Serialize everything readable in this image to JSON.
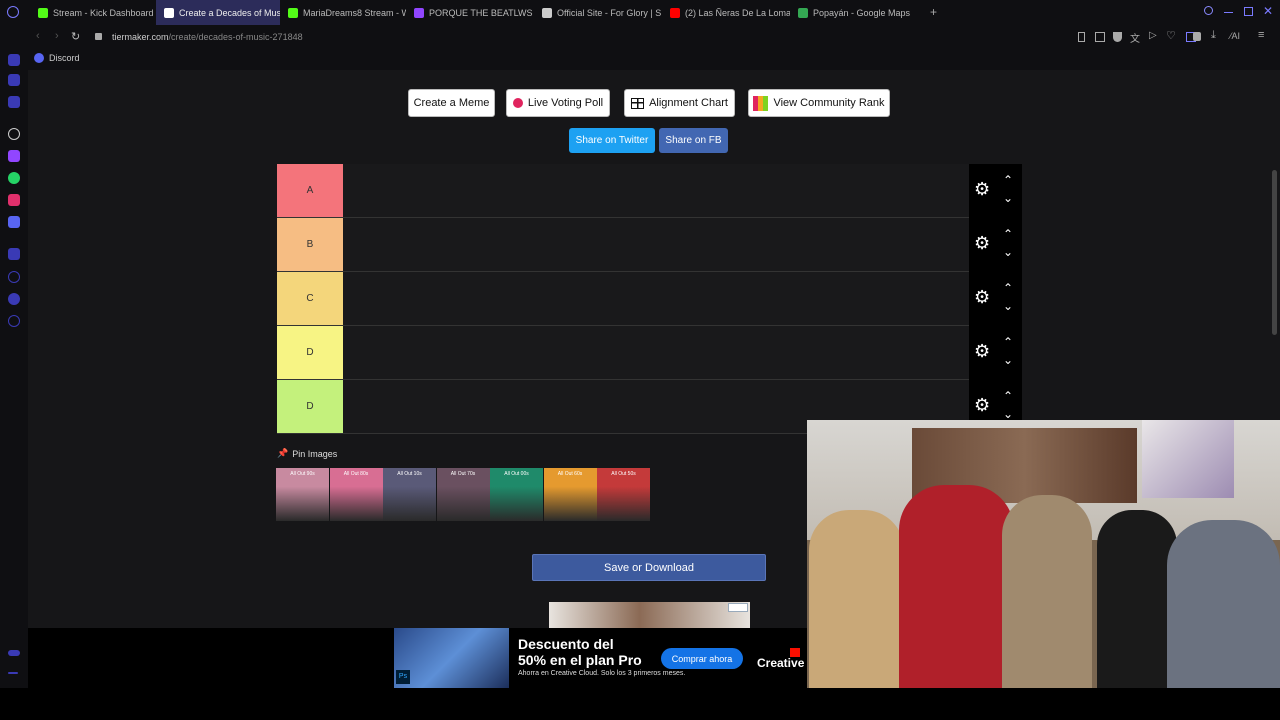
{
  "tabs": [
    {
      "label": "Stream - Kick Dashboard",
      "icon": "kick-icon",
      "color": "#53fc18"
    },
    {
      "label": "Create a Decades of Musi",
      "icon": "tiermaker-icon",
      "color": "#ffffff"
    },
    {
      "label": "MariaDreams8 Stream - W",
      "icon": "kick-icon",
      "color": "#53fc18"
    },
    {
      "label": "PORQUE THE BEATLWS S",
      "icon": "twitch-icon",
      "color": "#9146ff"
    },
    {
      "label": "Official Site - For Glory | S",
      "icon": "steam-icon",
      "color": "#cccccc"
    },
    {
      "label": "(2) Las Ñeras De La Loma",
      "icon": "youtube-icon",
      "color": "#ff0000"
    },
    {
      "label": "Popayán - Google Maps",
      "icon": "maps-icon",
      "color": "#34a853"
    }
  ],
  "url": {
    "domain": "tiermaker.com",
    "path": "/create/decades-of-music-271848"
  },
  "bookmark": {
    "label": "Discord"
  },
  "toolbar": {
    "create_meme": "Create a Meme",
    "live_voting": "Live Voting Poll",
    "alignment_chart": "Alignment Chart",
    "community_rank": "View Community Rank"
  },
  "share": {
    "twitter": "Share on Twitter",
    "fb": "Share on FB"
  },
  "tiers": [
    {
      "label": "A",
      "color": "#f4747b"
    },
    {
      "label": "B",
      "color": "#f6bd83"
    },
    {
      "label": "C",
      "color": "#f4d67b"
    },
    {
      "label": "D",
      "color": "#f7f484"
    },
    {
      "label": "D",
      "color": "#c4f17c"
    }
  ],
  "pin_images": {
    "label": "Pin Images"
  },
  "images": [
    {
      "caption": "All Out 90s",
      "color": "#c88aa0"
    },
    {
      "caption": "All Out 80s",
      "color": "#d86e93"
    },
    {
      "caption": "All Out 10s",
      "color": "#5a5a78"
    },
    {
      "caption": "All Out 70s",
      "color": "#6a5060"
    },
    {
      "caption": "All Out 00s",
      "color": "#1f8a6a"
    },
    {
      "caption": "All Out 60s",
      "color": "#e59a2f"
    },
    {
      "caption": "All Out 50s",
      "color": "#c43a3a"
    }
  ],
  "save_button": "Save or Download",
  "ad": {
    "headline1": "Descuento del",
    "headline2": "50% en el plan Pro",
    "subtext": "Ahorra en Creative Cloud. Solo los 3 primeros meses.",
    "cta": "Comprar ahora",
    "brand": "Creative"
  }
}
